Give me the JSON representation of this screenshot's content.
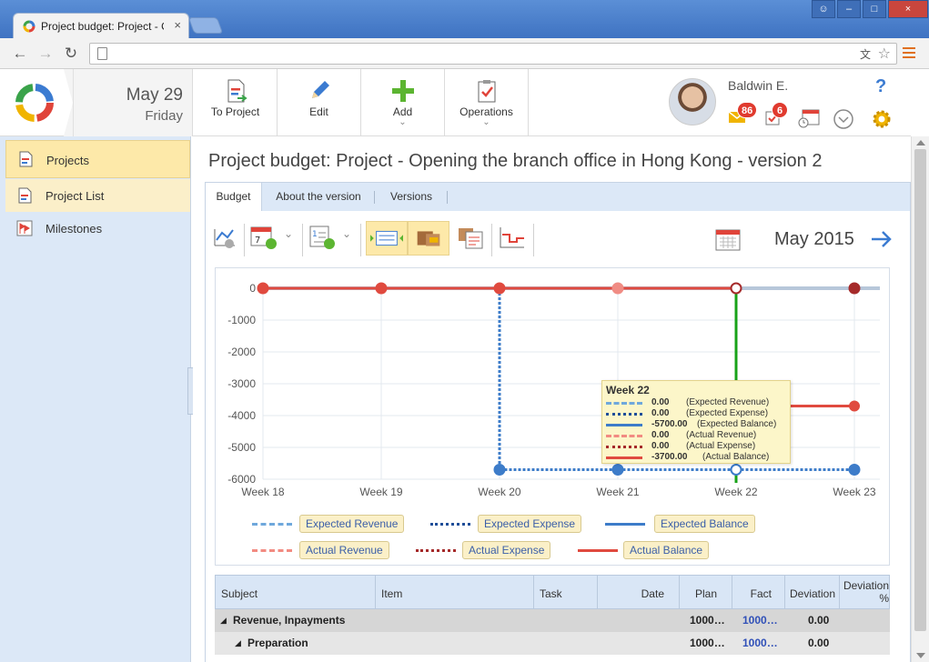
{
  "browser": {
    "tab_title": "Project budget: Project - Op",
    "url": ""
  },
  "header": {
    "date_day": "May 29",
    "date_weekday": "Friday",
    "toolbar": [
      {
        "label": "To Project",
        "icon": "to-project-icon"
      },
      {
        "label": "Edit",
        "icon": "pencil-icon"
      },
      {
        "label": "Add",
        "icon": "plus-icon",
        "has_menu": true
      },
      {
        "label": "Operations",
        "icon": "clipboard-check-icon",
        "has_menu": true
      }
    ],
    "user_name": "Baldwin E.",
    "mail_count": "86",
    "task_count": "6",
    "help_glyph": "?"
  },
  "sidebar": {
    "items": [
      {
        "label": "Projects",
        "icon": "projects-icon"
      },
      {
        "label": "Project List",
        "icon": "list-icon"
      },
      {
        "label": "Milestones",
        "icon": "milestones-icon"
      }
    ]
  },
  "main": {
    "page_title": "Project budget: Project - Opening the branch office in Hong Kong - version 2",
    "tabs": [
      {
        "label": "Budget"
      },
      {
        "label": "About the version"
      },
      {
        "label": "Versions"
      }
    ],
    "period_label": "May 2015"
  },
  "chart_data": {
    "type": "line",
    "categories": [
      "Week 18",
      "Week 19",
      "Week 20",
      "Week 21",
      "Week 22",
      "Week 23"
    ],
    "ylim": [
      -6000,
      0
    ],
    "yticks": [
      "0",
      "-1000",
      "-2000",
      "-3000",
      "-4000",
      "-5000",
      "-6000"
    ],
    "grid": true,
    "series": [
      {
        "name": "Expected Revenue",
        "color": "#6fa8dc",
        "style": "dashed",
        "values": [
          0,
          0,
          0,
          0,
          0,
          0
        ]
      },
      {
        "name": "Expected Expense",
        "color": "#1f4e99",
        "style": "dotted",
        "values": [
          0,
          0,
          0,
          0,
          0,
          0
        ]
      },
      {
        "name": "Expected Balance",
        "color": "#3d7cc9",
        "style": "solid",
        "values": [
          0,
          0,
          -5700,
          -5700,
          -5700,
          -5700
        ]
      },
      {
        "name": "Actual Revenue",
        "color": "#f28b82",
        "style": "dashed",
        "values": [
          0,
          0,
          0,
          0,
          0,
          0
        ]
      },
      {
        "name": "Actual Expense",
        "color": "#a52a2a",
        "style": "dotted",
        "values": [
          0,
          0,
          0,
          0,
          0,
          0
        ]
      },
      {
        "name": "Actual Balance",
        "color": "#e04a3f",
        "style": "solid",
        "values": [
          0,
          0,
          0,
          0,
          -3700,
          -3700
        ]
      }
    ],
    "tooltip": {
      "title": "Week 22",
      "rows": [
        {
          "value": "0.00",
          "name": "(Expected Revenue)"
        },
        {
          "value": "0.00",
          "name": "(Expected Expense)"
        },
        {
          "value": "-5700.00",
          "name": "(Expected Balance)"
        },
        {
          "value": "0.00",
          "name": "(Actual Revenue)"
        },
        {
          "value": "0.00",
          "name": "(Actual Expense)"
        },
        {
          "value": "-3700.00",
          "name": "(Actual Balance)"
        }
      ]
    }
  },
  "table": {
    "columns": [
      "Subject",
      "Item",
      "Task",
      "Date",
      "Plan",
      "Fact",
      "Deviation",
      "Deviation %"
    ],
    "rows": [
      {
        "subject": "Revenue, Inpayments",
        "plan": "1000…",
        "fact": "1000…",
        "deviation": "0.00"
      },
      {
        "subject": "Preparation",
        "plan": "1000…",
        "fact": "1000…",
        "deviation": "0.00"
      }
    ]
  }
}
